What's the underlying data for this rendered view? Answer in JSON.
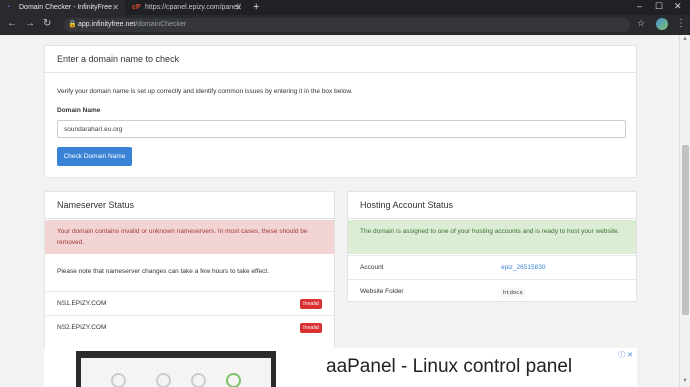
{
  "browser": {
    "tabs": [
      {
        "title": "Domain Checker - InfinityFree",
        "active": true
      },
      {
        "title": "https://cpanel.epizy.com/panel/",
        "active": false
      }
    ],
    "new_tab": "+",
    "url_host": "app.infinityfree.net",
    "url_path": "/domainChecker",
    "colors": {
      "tabbar": "#202124",
      "toolbar": "#292a2d"
    }
  },
  "checker": {
    "title": "Enter a domain name to check",
    "description": "Verify your domain name is set up correctly and identify common issues by entering it in the box below.",
    "field_label": "Domain Name",
    "field_value": "soundaraharI.eu.org",
    "button_label": "Check Domain Name"
  },
  "nameserver": {
    "title": "Nameserver Status",
    "alert": "Your domain contains invalid or unknown nameservers. In most cases, these should be removed.",
    "note": "Please note that nameserver changes can take a few hours to take effect.",
    "servers": [
      {
        "name": "NS1.EPIZY.COM",
        "status": "Invalid"
      },
      {
        "name": "NS2.EPIZY.COM",
        "status": "Invalid"
      }
    ]
  },
  "hosting": {
    "title": "Hosting Account Status",
    "alert": "The domain is assigned to one of your hosting accounts and is ready to host your website.",
    "rows": [
      {
        "label": "Account",
        "value": "epiz_26515830"
      },
      {
        "label": "Website Folder",
        "value": "htdocs"
      }
    ]
  },
  "ad": {
    "headline": "aaPanel - Linux control panel"
  },
  "colors": {
    "primary": "#3a82d6",
    "danger_bg": "#f2d4d4",
    "danger_text": "#a33a3a",
    "success_bg": "#dbeed5",
    "badge_red": "#d9312f"
  }
}
